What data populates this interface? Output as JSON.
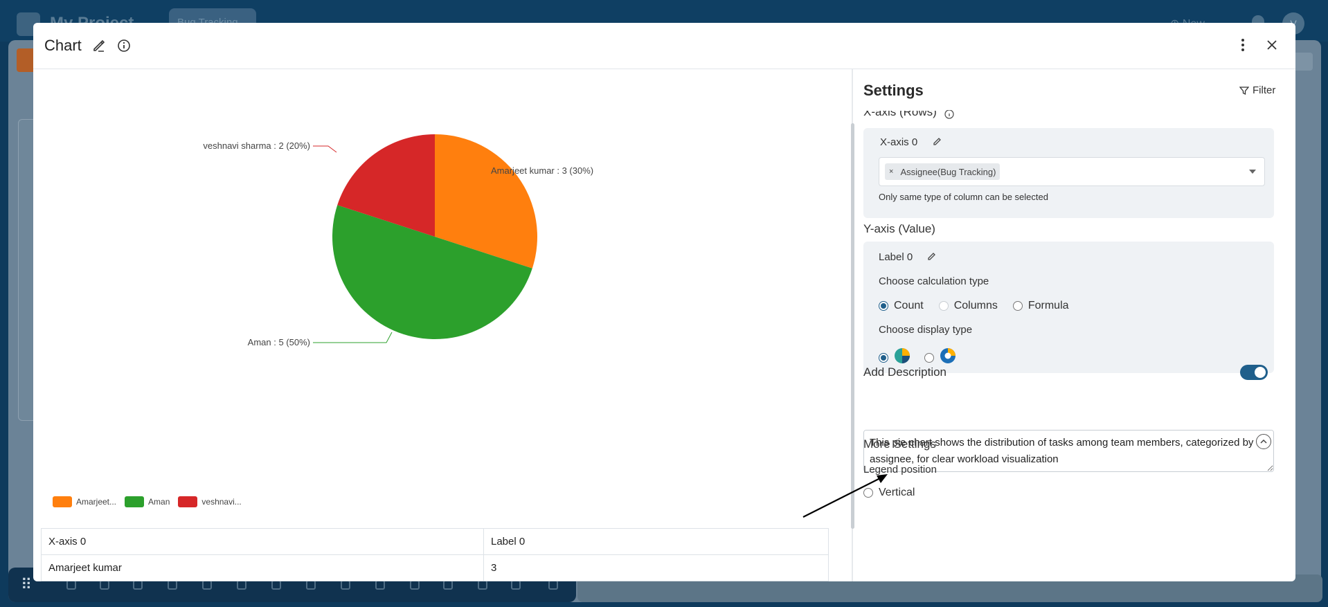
{
  "background": {
    "app_title": "My Project",
    "tab_label": "Bug Tracking",
    "new_label": "New",
    "avatar_initial": "V"
  },
  "modal": {
    "title": "Chart"
  },
  "chart_data": {
    "type": "pie",
    "categories": [
      "Amarjeet kumar",
      "Aman",
      "veshnavi sharma"
    ],
    "values": [
      3,
      5,
      2
    ],
    "percentages": [
      30,
      50,
      20
    ],
    "colors": [
      "#ff7f0e",
      "#2ca02c",
      "#d62728"
    ],
    "slice_labels": [
      "Amarjeet kumar : 3 (30%)",
      "Aman : 5 (50%)",
      "veshnavi sharma : 2 (20%)"
    ],
    "legend": [
      "Amarjeet...",
      "Aman",
      "veshnavi..."
    ],
    "legend_position": "bottom-left"
  },
  "table": {
    "headers": [
      "X-axis 0",
      "Label 0"
    ],
    "rows": [
      [
        "Amarjeet kumar",
        "3"
      ]
    ]
  },
  "settings": {
    "title": "Settings",
    "filter_label": "Filter",
    "x_axis_section": "X-axis (Rows)",
    "x_axis_name": "X-axis 0",
    "x_axis_chip": "Assignee(Bug Tracking)",
    "x_axis_hint": "Only same type of column can be selected",
    "y_axis_section": "Y-axis (Value)",
    "y_label_name": "Label 0",
    "calc_type_label": "Choose calculation type",
    "calc_options": [
      "Count",
      "Columns",
      "Formula"
    ],
    "calc_selected": "Count",
    "display_type_label": "Choose display type",
    "display_options": [
      "pie",
      "donut"
    ],
    "display_selected": "pie",
    "add_description_label": "Add Description",
    "add_description_enabled": true,
    "description_text": "This pie chart shows the distribution of tasks among team members, categorized by assignee, for clear workload visualization",
    "more_settings_label": "More Settings",
    "legend_position_label": "Legend position",
    "legend_position_options": [
      "Vertical"
    ]
  },
  "accent_color": "#1f5f8b"
}
